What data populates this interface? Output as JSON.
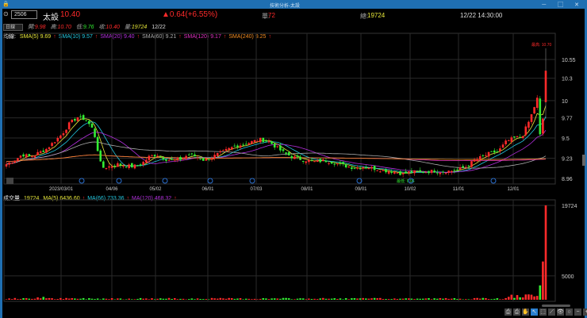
{
  "window": {
    "title": "技術分析-太設",
    "controls": "－ ▢ ✕"
  },
  "quote": {
    "code": "2506",
    "name": "太設",
    "price": "10.40",
    "change": "▲0.64(+6.55%)",
    "single_label": "單:",
    "single": "72",
    "total_label": "總:",
    "total": "19724",
    "datetime": "12/22 14:30:00"
  },
  "ohlc": {
    "period": "日線",
    "open_label": "開:",
    "open": "9.98",
    "high_label": "高:",
    "high": "10.70",
    "low_label": "低:",
    "low": "9.76",
    "close_label": "收:",
    "close": "10.40",
    "vol_label": "量:",
    "vol": "19724",
    "date": "12/22"
  },
  "indicators": {
    "label": "均線:",
    "items": [
      {
        "text": "SMA(5) 9.69",
        "color": "#e8e83a"
      },
      {
        "text": "SMA(10) 9.57",
        "color": "#22c8e0"
      },
      {
        "text": "SMA(20) 9.40",
        "color": "#b52fe0"
      },
      {
        "text": "SMA(60) 9.21",
        "color": "#aaaaaa"
      },
      {
        "text": "SMA(120) 9.17",
        "color": "#e030c0"
      },
      {
        "text": "SMA(240) 9.25",
        "color": "#f08a20"
      }
    ],
    "arrow": "↑"
  },
  "volume_indicators": {
    "label": "成交量",
    "value": "19724",
    "items": [
      {
        "text": "MA(5) 6436.60",
        "color": "#e8e83a"
      },
      {
        "text": "MA(66) 733.36",
        "color": "#22c8e0"
      },
      {
        "text": "MA(120) 468.32",
        "color": "#b52fe0"
      }
    ],
    "arrow": "↑"
  },
  "chart_data": {
    "type": "candlestick",
    "price_ticks": [
      10.55,
      10.3,
      10.0,
      9.77,
      9.5,
      9.23,
      8.96
    ],
    "ylim": [
      8.96,
      10.7
    ],
    "date_ticks": [
      "2023/03/01",
      "04/06",
      "05/02",
      "06/01",
      "07/03",
      "08/01",
      "09/01",
      "10/02",
      "11/01",
      "12/01"
    ],
    "high_annotation": "最高: 10.70",
    "low_annotation": "最低: 8.96",
    "closes": [
      9.15,
      9.2,
      9.28,
      9.25,
      9.3,
      9.35,
      9.45,
      9.55,
      9.7,
      9.78,
      9.75,
      9.6,
      9.1,
      9.12,
      9.15,
      9.13,
      9.12,
      9.15,
      9.25,
      9.28,
      9.22,
      9.2,
      9.22,
      9.28,
      9.25,
      9.2,
      9.25,
      9.3,
      9.35,
      9.4,
      9.42,
      9.45,
      9.48,
      9.46,
      9.38,
      9.3,
      9.25,
      9.22,
      9.2,
      9.18,
      9.2,
      9.18,
      9.15,
      9.12,
      9.1,
      9.12,
      9.1,
      9.08,
      9.06,
      9.05,
      9.02,
      9.05,
      9.04,
      9.05,
      9.06,
      9.05,
      9.06,
      9.08,
      9.12,
      9.2,
      9.25,
      9.3,
      9.32,
      9.45,
      9.5,
      9.52,
      9.75,
      10.05,
      10.4
    ],
    "volume_ticks": [
      19724,
      5000
    ],
    "volume_last": [
      3000,
      8000,
      19724
    ],
    "colors": {
      "up": "#ff2a2a",
      "down": "#33ee33",
      "grid": "#333333"
    }
  },
  "toolbar": [
    "⎙",
    "⎙",
    "✋",
    "↖",
    "⬚",
    "⟋",
    "👁",
    "○",
    "−",
    "+"
  ]
}
